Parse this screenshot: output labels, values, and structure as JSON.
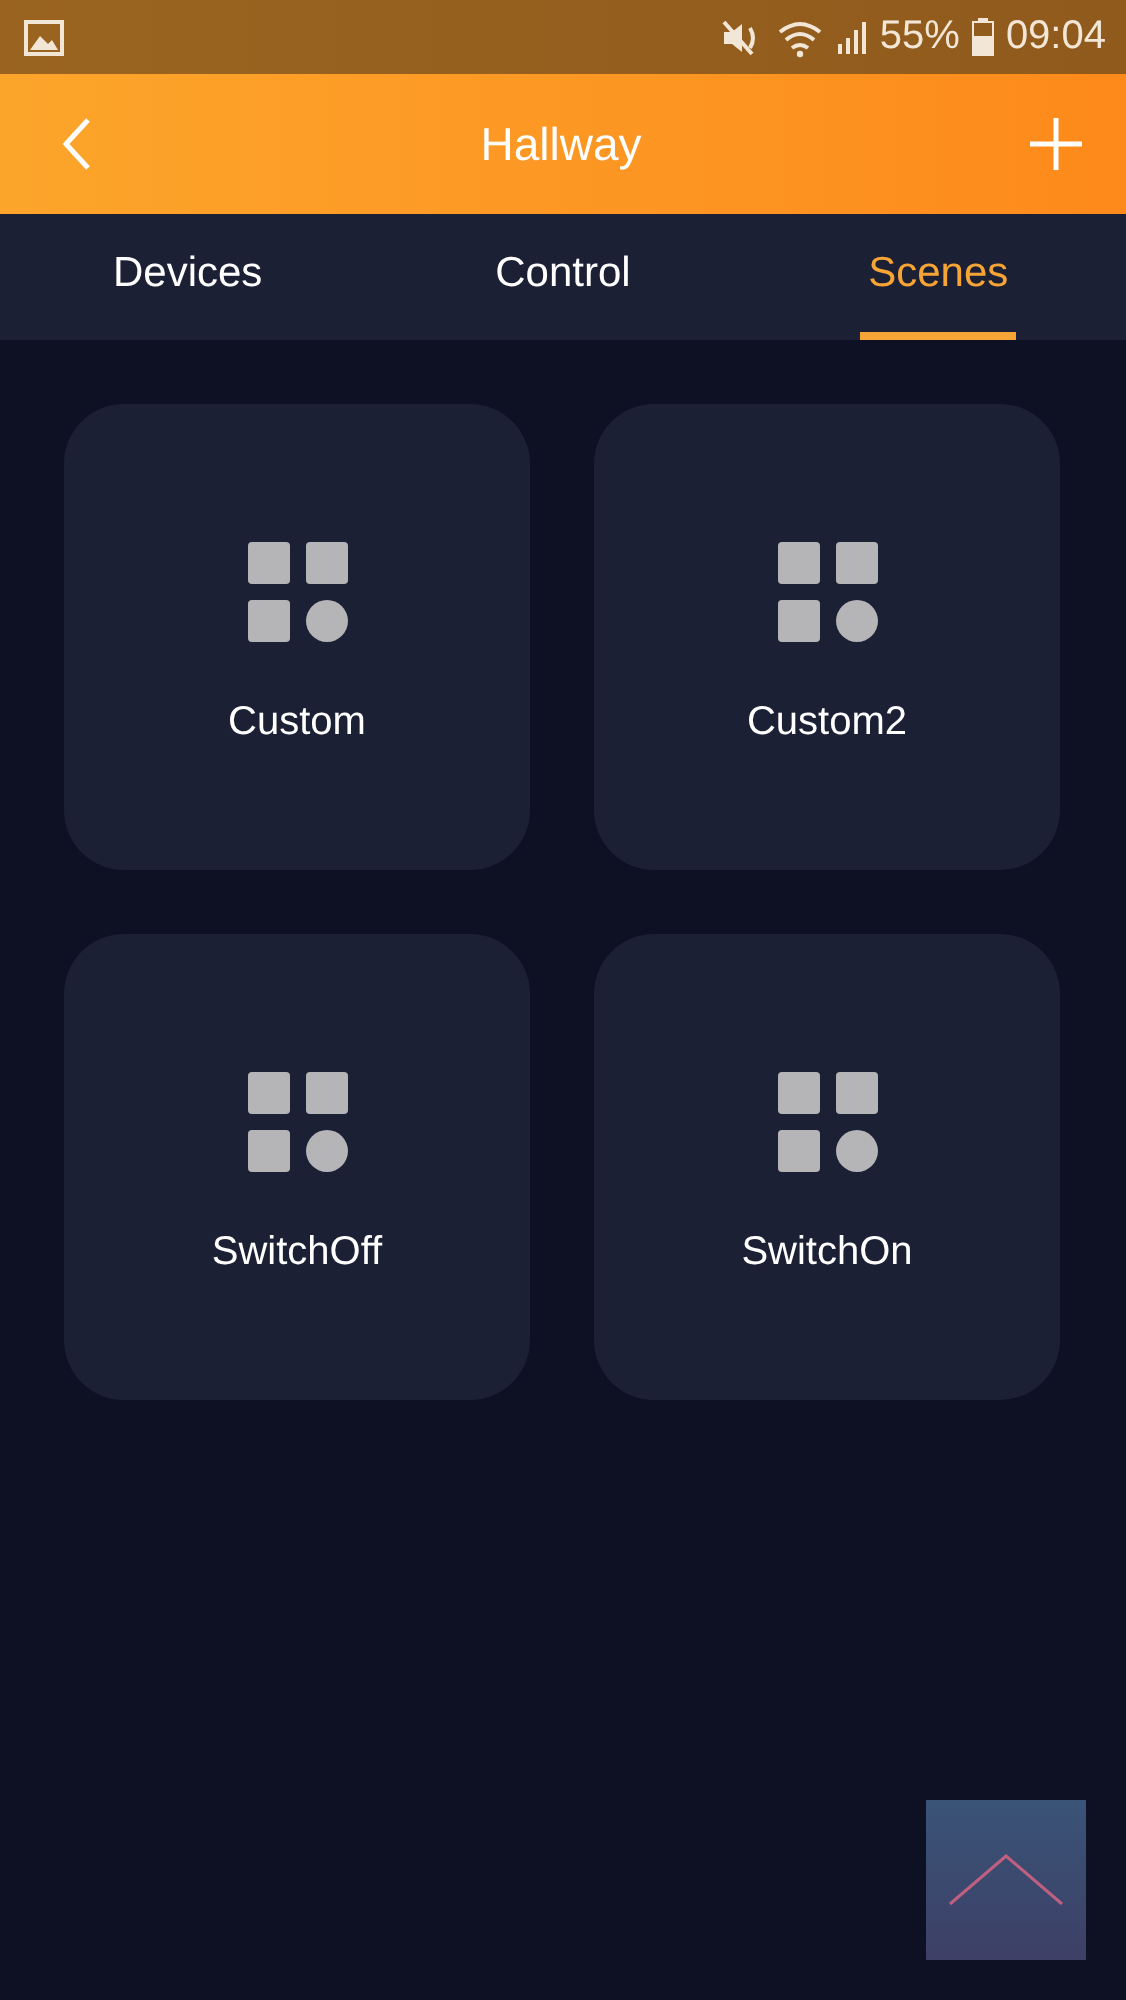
{
  "status_bar": {
    "battery": "55%",
    "time": "09:04"
  },
  "header": {
    "title": "Hallway"
  },
  "tabs": [
    {
      "label": "Devices",
      "selected": false
    },
    {
      "label": "Control",
      "selected": false
    },
    {
      "label": "Scenes",
      "selected": true
    }
  ],
  "scenes": [
    {
      "name": "Custom"
    },
    {
      "name": "Custom2"
    },
    {
      "name": "SwitchOff"
    },
    {
      "name": "SwitchOn"
    }
  ]
}
